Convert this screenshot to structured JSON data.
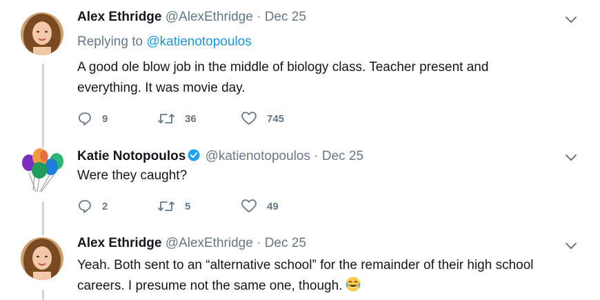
{
  "tweets": [
    {
      "author": {
        "name": "Alex Ethridge",
        "handle": "@AlexEthridge",
        "verified": false
      },
      "date": "Dec 25",
      "replying_label": "Replying to",
      "replying_to": "@katienotopoulos",
      "text_lines": [
        "A good ole blow job in the middle of biology class. Teacher present and",
        "everything. It was movie day."
      ],
      "stats": {
        "replies": "9",
        "retweets": "36",
        "likes": "745"
      }
    },
    {
      "author": {
        "name": "Katie Notopoulos",
        "handle": "@katienotopoulos",
        "verified": true
      },
      "date": "Dec 25",
      "text_lines": [
        "Were they caught?"
      ],
      "stats": {
        "replies": "2",
        "retweets": "5",
        "likes": "49"
      }
    },
    {
      "author": {
        "name": "Alex Ethridge",
        "handle": "@AlexEthridge",
        "verified": false
      },
      "date": "Dec 25",
      "text_lines": [
        "Yeah. Both sent to an “alternative school” for the remainder of their high school",
        "careers. I presume not the same one, though."
      ],
      "emoji": "face-with-tears-of-joy",
      "stats": {}
    }
  ],
  "separator": "·",
  "icons": {
    "reply": "reply-icon",
    "retweet": "retweet-icon",
    "like": "heart-icon",
    "menu": "chevron-down-icon",
    "verified": "verified-badge-icon"
  },
  "colors": {
    "link": "#1b95e0",
    "secondary_text": "#657786",
    "thread_line": "#ccd6dd",
    "verified": "#1da1f2"
  }
}
